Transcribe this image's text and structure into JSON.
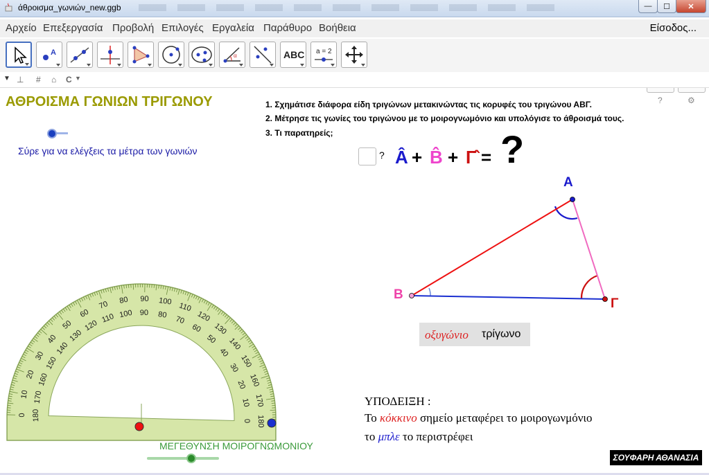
{
  "window": {
    "title": "άθροισμα_γωνιών_new.ggb",
    "buttons": {
      "minimize": "—",
      "maximize": "☐",
      "close": "✕"
    }
  },
  "menu": {
    "items": [
      "Αρχείο",
      "Επεξεργασία",
      "Προβολή",
      "Επιλογές",
      "Εργαλεία",
      "Παράθυρο",
      "Βοήθεια"
    ],
    "login": "Είσοδος..."
  },
  "toolbar": {
    "tools": [
      "move-tool",
      "point-tool",
      "line-tool",
      "perpendicular-line-tool",
      "polygon-tool",
      "circle-tool",
      "conic-tool",
      "angle-tool",
      "reflect-tool",
      "text-tool",
      "slider-tool",
      "move-graphics-tool"
    ],
    "text_tool_label": "ABC",
    "slider_tool_label": "a = 2",
    "undo": "↶",
    "redo": "↷",
    "help": "?",
    "settings": "⚙"
  },
  "stylebar": {
    "axes": "⊥",
    "grid": "#",
    "home": "⌂",
    "label_style": "C"
  },
  "content": {
    "heading": "ΑΘΡΟΙΣΜΑ ΓΩΝΙΩΝ ΤΡΙΓΩΝΟΥ",
    "drag_caption": "Σύρε για να ελέγξεις τα μέτρα των γωνιών",
    "instructions": [
      "1. Σχημάτισε διάφορα είδη τριγώνων μετακινώντας τις κορυφές του τριγώνου ΑΒΓ.",
      "2. Μέτρησε τις γωνίες του τριγώνου με το μοιρογνωμόνιο και υπολόγισε το άθροισμά τους.",
      "3. Τι παρατηρείς;"
    ],
    "checkbox_label": "?",
    "formula": {
      "a": "Â",
      "plus1": "+",
      "b": "B̂",
      "plus2": "+",
      "g": "Γ̂",
      "eq": "=",
      "q": "?"
    },
    "vertices": {
      "A": "Α",
      "B": "Β",
      "G": "Γ"
    },
    "triangle_type_word": "οξυγώνιο",
    "triangle_word": "τρίγωνο",
    "hint": {
      "title": "ΥΠΟΔΕΙΞΗ :",
      "line1_pre": "Το ",
      "line1_color": "κόκκινο",
      "line1_post": " σημείο μεταφέρει το μοιρογωνμόνιο",
      "line2_pre": "το ",
      "line2_color": "μπλε",
      "line2_post": " το περιστρέφει"
    },
    "zoom_label": "ΜΕΓΕΘΥΝΣΗ ΜΟΙΡΟΓΝΩΜΟΝΙΟΥ",
    "author": "ΣΟΥΦΑΡΗ ΑΘΑΝΑΣΙΑ"
  },
  "protractor": {
    "ticks_outer": [
      "0",
      "10",
      "20",
      "30",
      "40",
      "50",
      "60",
      "70",
      "80",
      "90",
      "100",
      "110",
      "120",
      "130",
      "140",
      "150",
      "160",
      "170",
      "180"
    ],
    "ticks_inner": [
      "180",
      "170",
      "160",
      "150",
      "140",
      "130",
      "120",
      "110",
      "100",
      "90",
      "80",
      "70",
      "60",
      "50",
      "40",
      "30",
      "20",
      "10",
      "0"
    ]
  },
  "colors": {
    "heading": "#9a9a00",
    "vertex_a": "#1a1acc",
    "vertex_b": "#ee44aa",
    "vertex_g": "#cc1111",
    "side_ab": "#ee1111",
    "side_bg": "#1a2fd0",
    "side_ag": "#f06ac0",
    "protractor_fill": "#d6e6a8",
    "protractor_stroke": "#8aa65a"
  }
}
